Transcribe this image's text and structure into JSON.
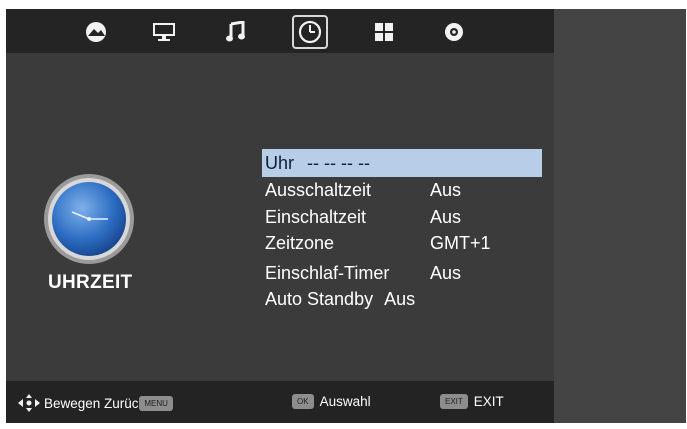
{
  "tabs": [
    {
      "name": "picture-icon",
      "active": false
    },
    {
      "name": "monitor-icon",
      "active": false
    },
    {
      "name": "music-icon",
      "active": false
    },
    {
      "name": "clock-icon",
      "active": true
    },
    {
      "name": "grid-icon",
      "active": false
    },
    {
      "name": "settings-icon",
      "active": false
    }
  ],
  "section": {
    "title": "UHRZEIT",
    "icon": "clock-icon"
  },
  "menu": {
    "clock": {
      "label": "Uhr",
      "value": "-- -- -- --"
    },
    "off_timer": {
      "label": "Ausschaltzeit",
      "value": "Aus"
    },
    "on_timer": {
      "label": "Einschaltzeit",
      "value": "Aus"
    },
    "timezone": {
      "label": "Zeitzone",
      "value": "GMT+1"
    },
    "sleep_timer": {
      "label": "Einschlaf-Timer",
      "value": "Aus"
    },
    "auto_standby": {
      "label": "Auto Standby",
      "value": "Aus"
    }
  },
  "footer": {
    "move_back": "Bewegen Zurück",
    "menu_key": "MENU",
    "ok_key": "OK",
    "select": "Auswahl",
    "exit_key": "EXIT",
    "exit": "EXIT"
  },
  "colors": {
    "highlight": "#b7cde8",
    "background": "#3b3b3b",
    "bar": "#242424"
  }
}
